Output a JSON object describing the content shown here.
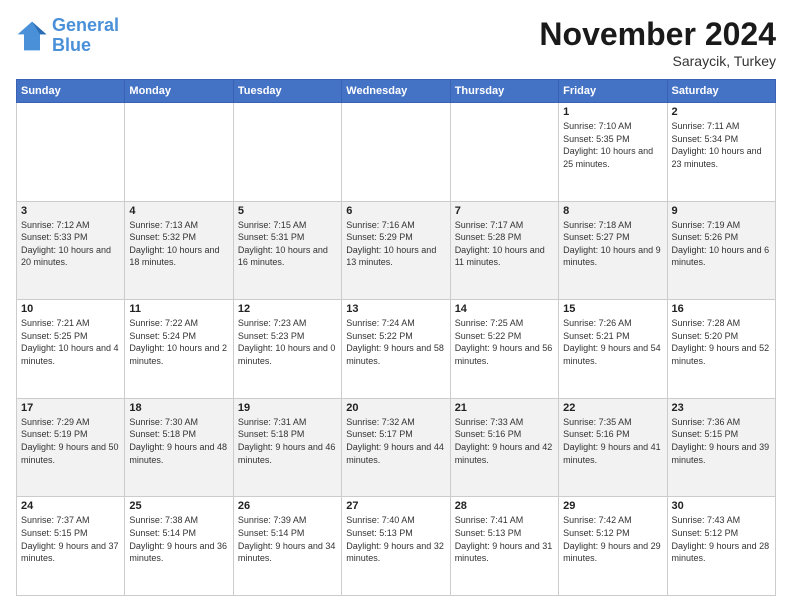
{
  "logo": {
    "line1": "General",
    "line2": "Blue"
  },
  "title": "November 2024",
  "subtitle": "Saraycik, Turkey",
  "days_header": [
    "Sunday",
    "Monday",
    "Tuesday",
    "Wednesday",
    "Thursday",
    "Friday",
    "Saturday"
  ],
  "weeks": [
    [
      {
        "day": "",
        "info": ""
      },
      {
        "day": "",
        "info": ""
      },
      {
        "day": "",
        "info": ""
      },
      {
        "day": "",
        "info": ""
      },
      {
        "day": "",
        "info": ""
      },
      {
        "day": "1",
        "info": "Sunrise: 7:10 AM\nSunset: 5:35 PM\nDaylight: 10 hours and 25 minutes."
      },
      {
        "day": "2",
        "info": "Sunrise: 7:11 AM\nSunset: 5:34 PM\nDaylight: 10 hours and 23 minutes."
      }
    ],
    [
      {
        "day": "3",
        "info": "Sunrise: 7:12 AM\nSunset: 5:33 PM\nDaylight: 10 hours and 20 minutes."
      },
      {
        "day": "4",
        "info": "Sunrise: 7:13 AM\nSunset: 5:32 PM\nDaylight: 10 hours and 18 minutes."
      },
      {
        "day": "5",
        "info": "Sunrise: 7:15 AM\nSunset: 5:31 PM\nDaylight: 10 hours and 16 minutes."
      },
      {
        "day": "6",
        "info": "Sunrise: 7:16 AM\nSunset: 5:29 PM\nDaylight: 10 hours and 13 minutes."
      },
      {
        "day": "7",
        "info": "Sunrise: 7:17 AM\nSunset: 5:28 PM\nDaylight: 10 hours and 11 minutes."
      },
      {
        "day": "8",
        "info": "Sunrise: 7:18 AM\nSunset: 5:27 PM\nDaylight: 10 hours and 9 minutes."
      },
      {
        "day": "9",
        "info": "Sunrise: 7:19 AM\nSunset: 5:26 PM\nDaylight: 10 hours and 6 minutes."
      }
    ],
    [
      {
        "day": "10",
        "info": "Sunrise: 7:21 AM\nSunset: 5:25 PM\nDaylight: 10 hours and 4 minutes."
      },
      {
        "day": "11",
        "info": "Sunrise: 7:22 AM\nSunset: 5:24 PM\nDaylight: 10 hours and 2 minutes."
      },
      {
        "day": "12",
        "info": "Sunrise: 7:23 AM\nSunset: 5:23 PM\nDaylight: 10 hours and 0 minutes."
      },
      {
        "day": "13",
        "info": "Sunrise: 7:24 AM\nSunset: 5:22 PM\nDaylight: 9 hours and 58 minutes."
      },
      {
        "day": "14",
        "info": "Sunrise: 7:25 AM\nSunset: 5:22 PM\nDaylight: 9 hours and 56 minutes."
      },
      {
        "day": "15",
        "info": "Sunrise: 7:26 AM\nSunset: 5:21 PM\nDaylight: 9 hours and 54 minutes."
      },
      {
        "day": "16",
        "info": "Sunrise: 7:28 AM\nSunset: 5:20 PM\nDaylight: 9 hours and 52 minutes."
      }
    ],
    [
      {
        "day": "17",
        "info": "Sunrise: 7:29 AM\nSunset: 5:19 PM\nDaylight: 9 hours and 50 minutes."
      },
      {
        "day": "18",
        "info": "Sunrise: 7:30 AM\nSunset: 5:18 PM\nDaylight: 9 hours and 48 minutes."
      },
      {
        "day": "19",
        "info": "Sunrise: 7:31 AM\nSunset: 5:18 PM\nDaylight: 9 hours and 46 minutes."
      },
      {
        "day": "20",
        "info": "Sunrise: 7:32 AM\nSunset: 5:17 PM\nDaylight: 9 hours and 44 minutes."
      },
      {
        "day": "21",
        "info": "Sunrise: 7:33 AM\nSunset: 5:16 PM\nDaylight: 9 hours and 42 minutes."
      },
      {
        "day": "22",
        "info": "Sunrise: 7:35 AM\nSunset: 5:16 PM\nDaylight: 9 hours and 41 minutes."
      },
      {
        "day": "23",
        "info": "Sunrise: 7:36 AM\nSunset: 5:15 PM\nDaylight: 9 hours and 39 minutes."
      }
    ],
    [
      {
        "day": "24",
        "info": "Sunrise: 7:37 AM\nSunset: 5:15 PM\nDaylight: 9 hours and 37 minutes."
      },
      {
        "day": "25",
        "info": "Sunrise: 7:38 AM\nSunset: 5:14 PM\nDaylight: 9 hours and 36 minutes."
      },
      {
        "day": "26",
        "info": "Sunrise: 7:39 AM\nSunset: 5:14 PM\nDaylight: 9 hours and 34 minutes."
      },
      {
        "day": "27",
        "info": "Sunrise: 7:40 AM\nSunset: 5:13 PM\nDaylight: 9 hours and 32 minutes."
      },
      {
        "day": "28",
        "info": "Sunrise: 7:41 AM\nSunset: 5:13 PM\nDaylight: 9 hours and 31 minutes."
      },
      {
        "day": "29",
        "info": "Sunrise: 7:42 AM\nSunset: 5:12 PM\nDaylight: 9 hours and 29 minutes."
      },
      {
        "day": "30",
        "info": "Sunrise: 7:43 AM\nSunset: 5:12 PM\nDaylight: 9 hours and 28 minutes."
      }
    ]
  ]
}
